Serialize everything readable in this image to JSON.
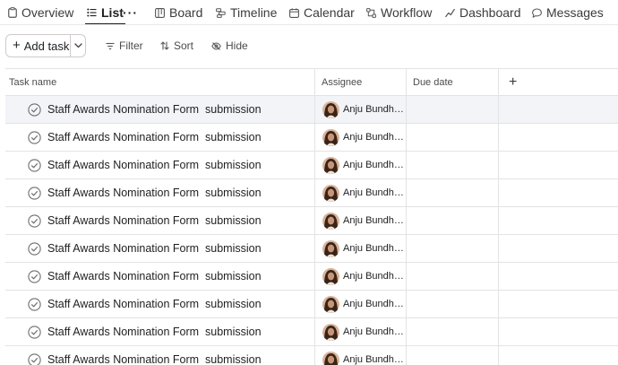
{
  "tabs": [
    {
      "label": "Overview",
      "icon": "clipboard-icon",
      "active": false
    },
    {
      "label": "List",
      "icon": "list-icon",
      "active": true
    },
    {
      "label": "Board",
      "icon": "board-icon",
      "active": false
    },
    {
      "label": "Timeline",
      "icon": "timeline-icon",
      "active": false
    },
    {
      "label": "Calendar",
      "icon": "calendar-icon",
      "active": false
    },
    {
      "label": "Workflow",
      "icon": "workflow-icon",
      "active": false
    },
    {
      "label": "Dashboard",
      "icon": "dashboard-icon",
      "active": false
    },
    {
      "label": "Messages",
      "icon": "message-icon",
      "active": false
    }
  ],
  "tab_more": "···",
  "toolbar": {
    "add_task": "Add task",
    "filter": "Filter",
    "sort": "Sort",
    "hide": "Hide"
  },
  "table": {
    "columns": [
      "Task name",
      "Assignee",
      "Due date"
    ],
    "add_column": "+",
    "rows": [
      {
        "task": "Staff Awards Nomination Form  submission",
        "assignee": "Anju Bundhun",
        "due": ""
      },
      {
        "task": "Staff Awards Nomination Form  submission",
        "assignee": "Anju Bundhun",
        "due": ""
      },
      {
        "task": "Staff Awards Nomination Form  submission",
        "assignee": "Anju Bundhun",
        "due": ""
      },
      {
        "task": "Staff Awards Nomination Form  submission",
        "assignee": "Anju Bundhun",
        "due": ""
      },
      {
        "task": "Staff Awards Nomination Form  submission",
        "assignee": "Anju Bundhun",
        "due": ""
      },
      {
        "task": "Staff Awards Nomination Form  submission",
        "assignee": "Anju Bundhun",
        "due": ""
      },
      {
        "task": "Staff Awards Nomination Form  submission",
        "assignee": "Anju Bundhun",
        "due": ""
      },
      {
        "task": "Staff Awards Nomination Form  submission",
        "assignee": "Anju Bundhun",
        "due": ""
      },
      {
        "task": "Staff Awards Nomination Form  submission",
        "assignee": "Anju Bundhun",
        "due": ""
      },
      {
        "task": "Staff Awards Nomination Form  submission",
        "assignee": "Anju Bundhun",
        "due": ""
      }
    ]
  },
  "colors": {
    "selected_row": "#f3f4f8",
    "border": "#e3e3e3",
    "text": "#1e1f21"
  }
}
